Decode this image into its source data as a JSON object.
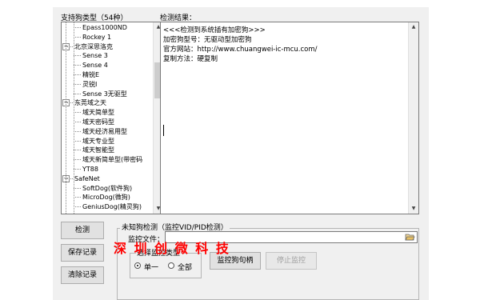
{
  "tree_panel": {
    "title": "支持狗类型（54种）",
    "items": [
      {
        "label": "Epass1000ND",
        "level": 1
      },
      {
        "label": "Rockey 1",
        "level": 1
      },
      {
        "label": "北京深思洛克",
        "level": 0,
        "expander": "−"
      },
      {
        "label": "Sense 3",
        "level": 1
      },
      {
        "label": "Sense 4",
        "level": 1
      },
      {
        "label": "精锐E",
        "level": 1
      },
      {
        "label": "灵锐I",
        "level": 1
      },
      {
        "label": "Sense 3无驱型",
        "level": 1
      },
      {
        "label": "东莞域之天",
        "level": 0,
        "expander": "−"
      },
      {
        "label": "域天简单型",
        "level": 1
      },
      {
        "label": "域天密码型",
        "level": 1
      },
      {
        "label": "域天经济易用型",
        "level": 1
      },
      {
        "label": "域天专业型",
        "level": 1
      },
      {
        "label": "域天智能型",
        "level": 1
      },
      {
        "label": "域天新简单型(带密码",
        "level": 1
      },
      {
        "label": "YT88",
        "level": 1
      },
      {
        "label": "SafeNet",
        "level": 0,
        "expander": "−"
      },
      {
        "label": "SoftDog(软件狗)",
        "level": 1
      },
      {
        "label": "MicroDog(微狗)",
        "level": 1
      },
      {
        "label": "GeniusDog(精灵狗)",
        "level": 1
      }
    ]
  },
  "result_panel": {
    "title": "检测结果：",
    "lines": [
      "<<<检测到系统插有加密狗>>>",
      "加密狗型号：无驱动型加密狗",
      "官方网站：http://www.chuangwei-ic-mcu.com/",
      "复制方法：硬复制"
    ]
  },
  "buttons": {
    "detect": "检测",
    "save": "保存记录",
    "clear": "清除记录",
    "monitor": "监控狗句柄",
    "stop_monitor": "停止监控"
  },
  "unknown_group": {
    "title": "未知狗检测（监控VID/PID检测）",
    "file_label": "监控文件：",
    "file_value": "",
    "select_title": "选择监控类型",
    "radio_single": "单一",
    "radio_all": "全部"
  },
  "watermark": {
    "text": "深 圳 创 微 科 技",
    "color": "#ff0000"
  },
  "icons": {
    "browse": "folder-open-icon"
  }
}
